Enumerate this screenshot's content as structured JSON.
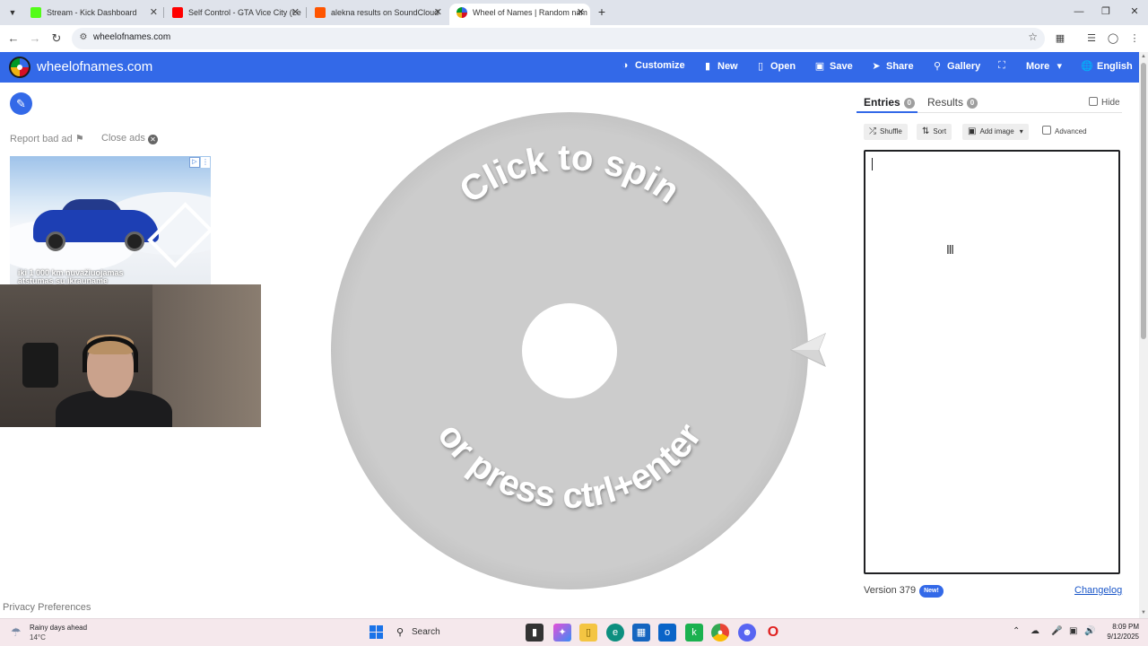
{
  "browser": {
    "tabs": [
      {
        "title": "Stream - Kick Dashboard",
        "favicon_color": "#53fc18"
      },
      {
        "title": "Self Control - GTA Vice City (Le",
        "favicon_color": "#ff0000"
      },
      {
        "title": "alekna results on SoundCloud",
        "favicon_color": "#ff5500"
      },
      {
        "title": "Wheel of Names | Random nam",
        "favicon_color": "#4285f4",
        "active": true
      }
    ],
    "url": "wheelofnames.com"
  },
  "header": {
    "site_name": "wheelofnames.com",
    "buttons": [
      {
        "label": "Customize",
        "icon": "palette-icon"
      },
      {
        "label": "New",
        "icon": "file-icon"
      },
      {
        "label": "Open",
        "icon": "folder-open-icon"
      },
      {
        "label": "Save",
        "icon": "save-icon"
      },
      {
        "label": "Share",
        "icon": "share-icon"
      },
      {
        "label": "Gallery",
        "icon": "search-icon"
      },
      {
        "label": "",
        "icon": "fullscreen-icon"
      },
      {
        "label": "More",
        "icon": "chevron-down-icon"
      },
      {
        "label": "English",
        "icon": "globe-icon"
      }
    ],
    "color": "#3369e8"
  },
  "left": {
    "report_bad_ad": "Report bad ad",
    "close_ads": "Close ads",
    "ad_text": "iki 1 000 km nuvažiuojamas atstumas su įkrauname",
    "privacy": "Privacy Preferences"
  },
  "wheel": {
    "top_text": "Click to spin",
    "bottom_text": "or press ctrl+enter"
  },
  "panel": {
    "entries_label": "Entries",
    "entries_count": "0",
    "results_label": "Results",
    "results_count": "0",
    "hide_label": "Hide",
    "shuffle_label": "Shuffle",
    "sort_label": "Sort",
    "add_image_label": "Add image",
    "advanced_label": "Advanced",
    "version": "Version 379",
    "new_badge": "New!",
    "changelog": "Changelog"
  },
  "taskbar": {
    "weather_title": "Rainy days ahead",
    "weather_temp": "14°C",
    "search_label": "Search",
    "time": "8:09 PM",
    "date": "9/12/2025"
  }
}
